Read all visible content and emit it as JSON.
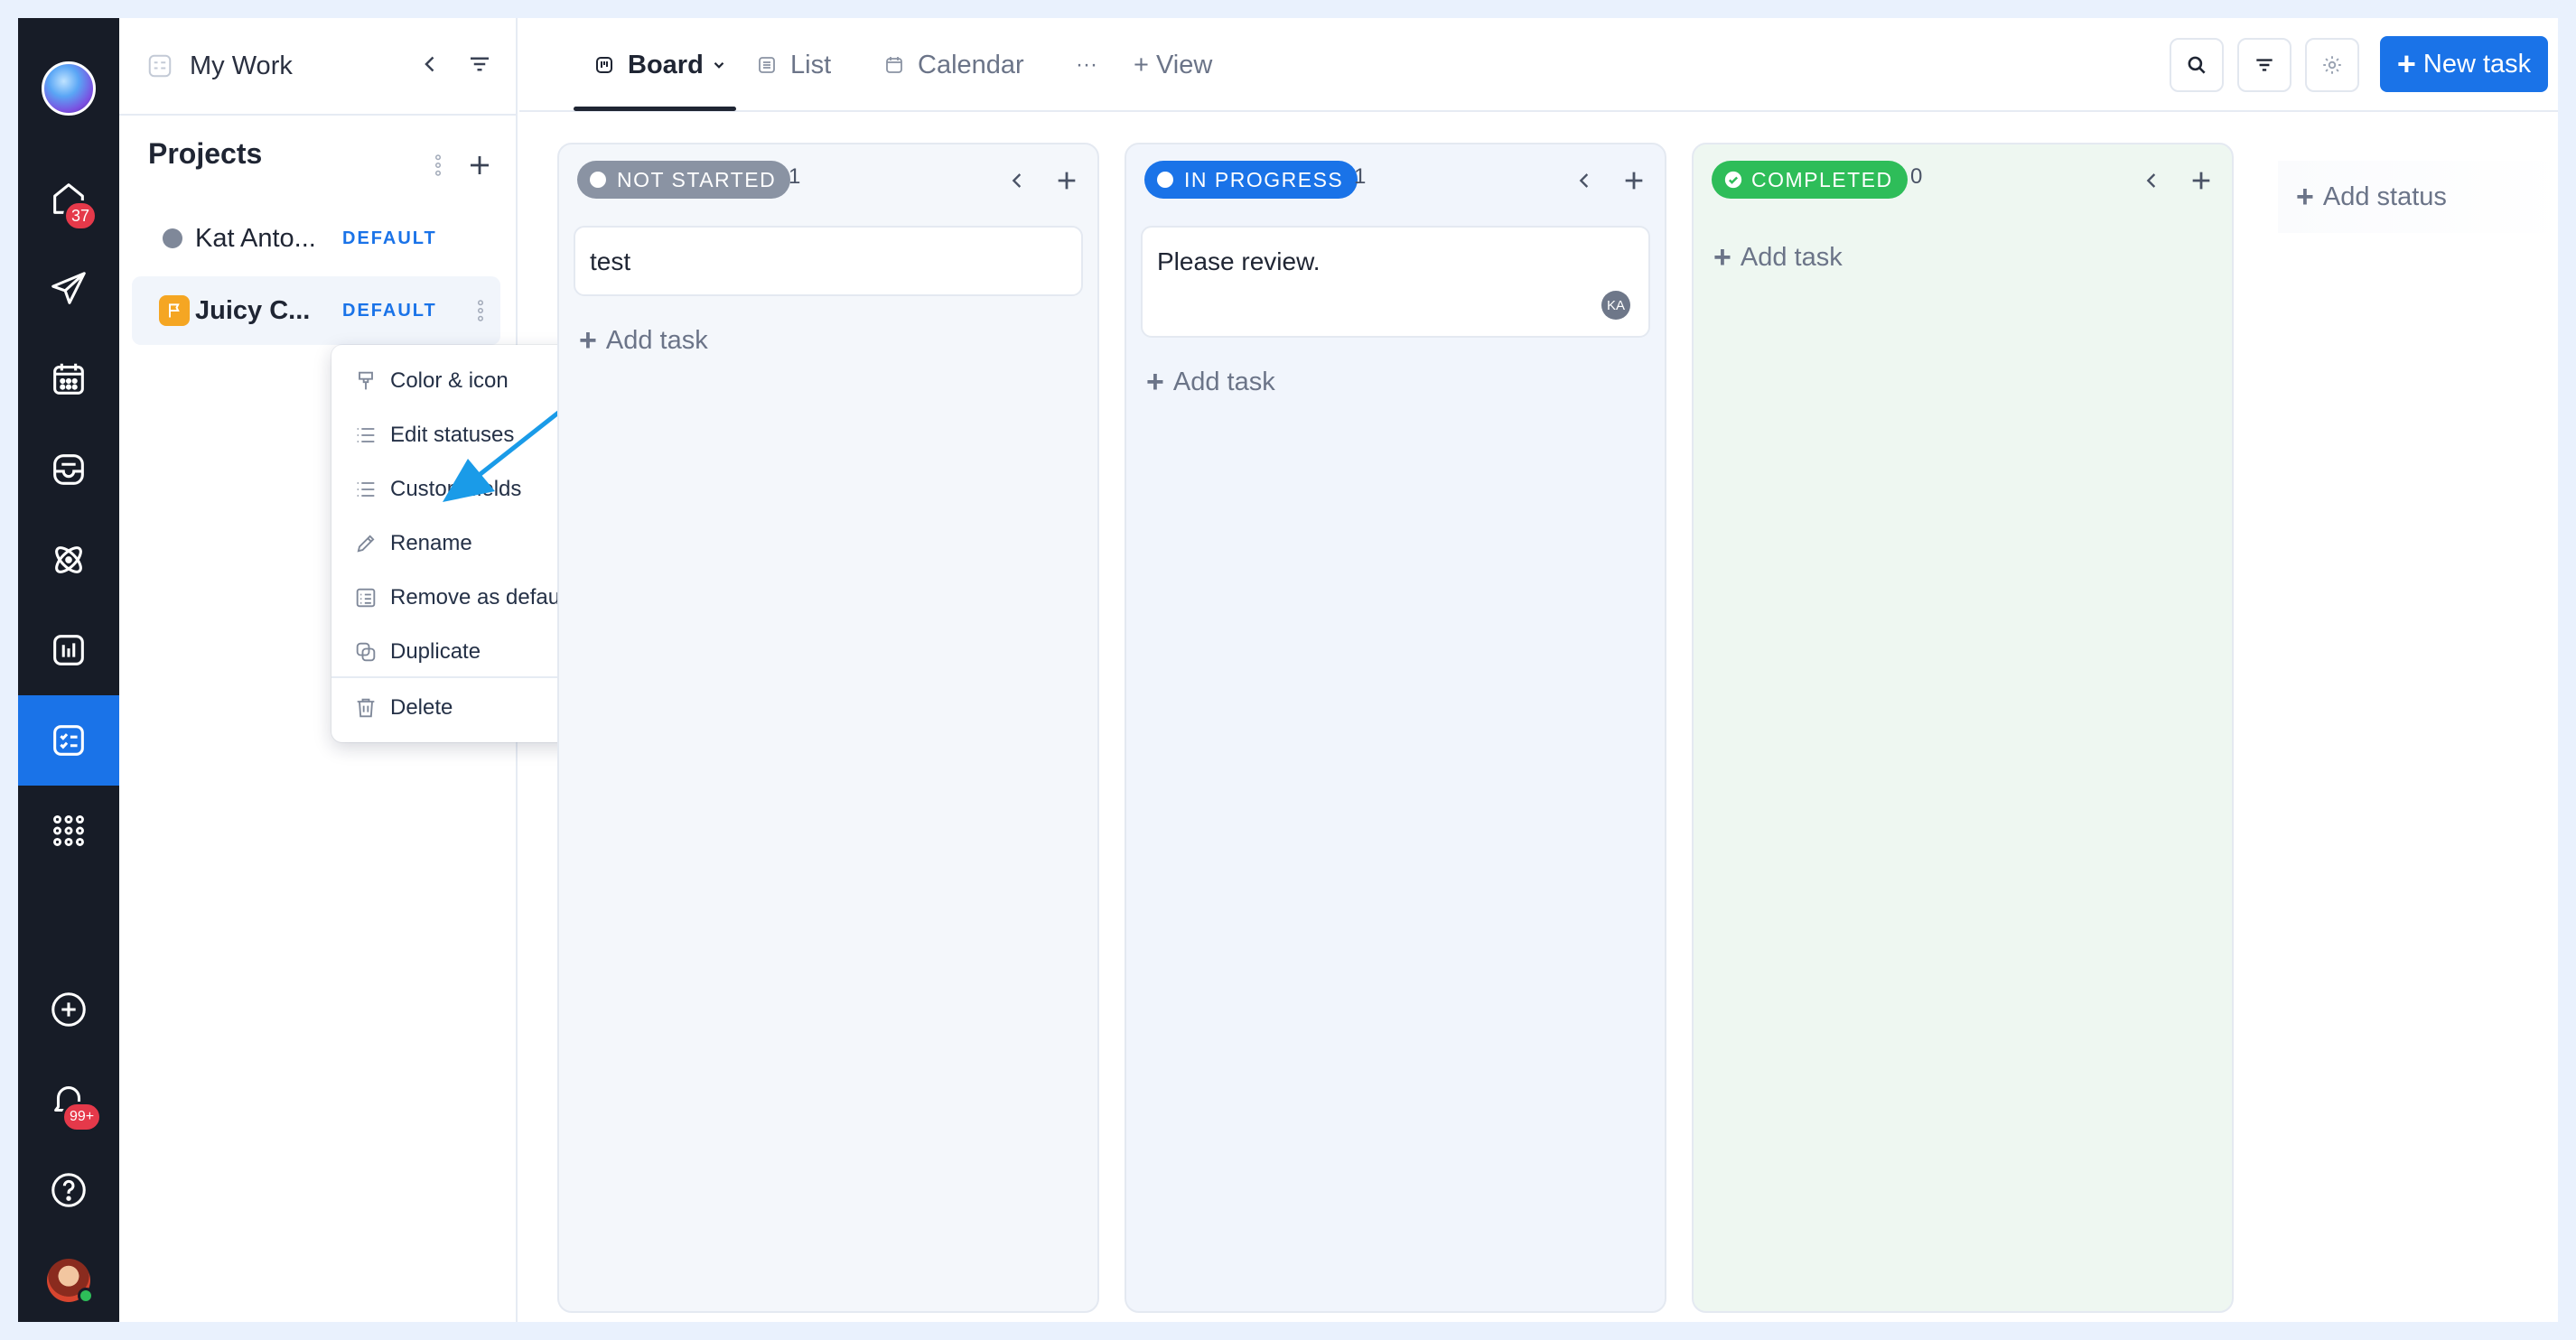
{
  "rail": {
    "home_badge": "37",
    "notifications_badge": "99+"
  },
  "sidebar": {
    "header_title": "My Work",
    "projects_title": "Projects",
    "projects": [
      {
        "name": "Kat Anto...",
        "tag": "DEFAULT"
      },
      {
        "name": "Juicy C...",
        "tag": "DEFAULT"
      }
    ]
  },
  "context_menu": {
    "items": [
      {
        "label": "Color & icon",
        "icon": "paint-brush-icon"
      },
      {
        "label": "Edit statuses",
        "icon": "list-icon"
      },
      {
        "label": "Custom fields",
        "icon": "list-icon"
      },
      {
        "label": "Rename",
        "icon": "pencil-icon"
      },
      {
        "label": "Remove as default",
        "icon": "checklist-icon"
      },
      {
        "label": "Duplicate",
        "icon": "duplicate-icon"
      },
      {
        "label": "Delete",
        "icon": "trash-icon"
      }
    ]
  },
  "topbar": {
    "tabs": [
      {
        "label": "Board",
        "icon": "board-icon"
      },
      {
        "label": "List",
        "icon": "list-icon"
      },
      {
        "label": "Calendar",
        "icon": "calendar-icon"
      }
    ],
    "more_label": "···",
    "add_view_label": "+ View",
    "new_task_label": "New task"
  },
  "board": {
    "columns": [
      {
        "status": "NOT STARTED",
        "count": "1",
        "color": "#8a93a3",
        "cards": [
          {
            "title": "test"
          }
        ],
        "add_task": "Add task"
      },
      {
        "status": "IN PROGRESS",
        "count": "1",
        "color": "#1a73e8",
        "cards": [
          {
            "title": "Please review.",
            "assignee": "KA"
          }
        ],
        "add_task": "Add task"
      },
      {
        "status": "COMPLETED",
        "count": "0",
        "color": "#2ebd59",
        "cards": [],
        "add_task": "Add task"
      }
    ],
    "add_status": "Add status"
  },
  "colors": {
    "accent": "#1a73e8",
    "rail_bg": "#171c27",
    "annotation_arrow": "#1a9be8"
  }
}
